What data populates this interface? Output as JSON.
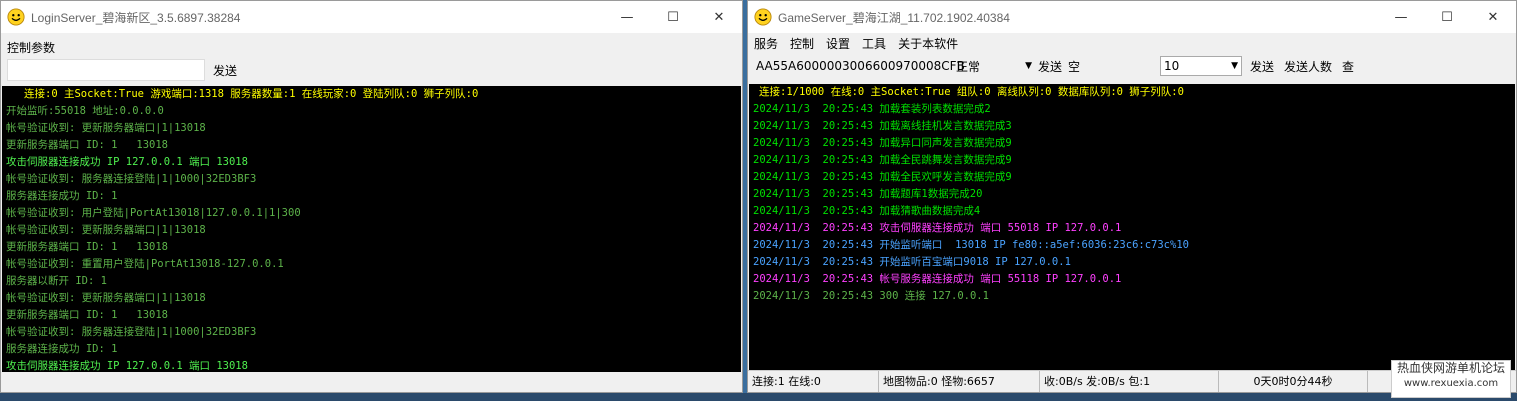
{
  "left": {
    "title": "LoginServer_碧海新区_3.5.6897.38284",
    "menu": [
      "控制参数"
    ],
    "send_label": "发送",
    "console_header": "连接:0 主Socket:True 游戏端口:1318 服务器数量:1 在线玩家:0 登陆列队:0 狮子列队:0",
    "lines": [
      {
        "t": "开始监听:55018 地址:0.0.0.0",
        "c": "dg"
      },
      {
        "t": "帐号验证收到: 更新服务器端口|1|13018",
        "c": "dg"
      },
      {
        "t": "更新服务器端口 ID: 1   13018",
        "c": "dg"
      },
      {
        "t": "攻击伺服器连接成功 IP 127.0.0.1 端口 13018",
        "c": "bg"
      },
      {
        "t": "帐号验证收到: 服务器连接登陆|1|1000|32ED3BF3",
        "c": "dg"
      },
      {
        "t": "服务器连接成功 ID: 1",
        "c": "dg"
      },
      {
        "t": "帐号验证收到: 用户登陆|PortAt13018|127.0.0.1|1|300",
        "c": "dg"
      },
      {
        "t": "帐号验证收到: 更新服务器端口|1|13018",
        "c": "dg"
      },
      {
        "t": "更新服务器端口 ID: 1   13018",
        "c": "dg"
      },
      {
        "t": "帐号验证收到: 重置用户登陆|PortAt13018-127.0.0.1",
        "c": "dg"
      },
      {
        "t": "服务器以断开 ID: 1",
        "c": "dg"
      },
      {
        "t": "帐号验证收到: 更新服务器端口|1|13018",
        "c": "dg"
      },
      {
        "t": "更新服务器端口 ID: 1   13018",
        "c": "dg"
      },
      {
        "t": "帐号验证收到: 服务器连接登陆|1|1000|32ED3BF3",
        "c": "dg"
      },
      {
        "t": "服务器连接成功 ID: 1",
        "c": "dg"
      },
      {
        "t": "攻击伺服器连接成功 IP 127.0.0.1 端口 13018",
        "c": "bg"
      }
    ]
  },
  "right": {
    "title": "GameServer_碧海江湖_11.702.1902.40384",
    "menu": [
      "服务",
      "控制",
      "设置",
      "工具",
      "关于本软件"
    ],
    "toolbar": {
      "id": "AA55A6000003006600970008CFB",
      "mode": "正常",
      "send1": "发送",
      "empty": "空",
      "count": "10",
      "send2": "发送",
      "send_count": "发送人数",
      "query": "查"
    },
    "console_header": "连接:1/1000 在线:0 主Socket:True 组队:0 离线队列:0 数据库队列:0 狮子列队:0",
    "lines": [
      {
        "t": "2024/11/3  20:25:43 加载套装列表数据完成2",
        "c": "g"
      },
      {
        "t": "2024/11/3  20:25:43 加载离线挂机发言数据完成3",
        "c": "g"
      },
      {
        "t": "2024/11/3  20:25:43 加载异口同声发言数据完成9",
        "c": "g"
      },
      {
        "t": "2024/11/3  20:25:43 加载全民跳舞发言数据完成9",
        "c": "g"
      },
      {
        "t": "2024/11/3  20:25:43 加载全民欢呼发言数据完成9",
        "c": "g"
      },
      {
        "t": "2024/11/3  20:25:43 加载题库1数据完成20",
        "c": "g"
      },
      {
        "t": "2024/11/3  20:25:43 加载猜歌曲数据完成4",
        "c": "g"
      },
      {
        "t": "2024/11/3  20:25:43 攻击伺服器连接成功 端口 55018 IP 127.0.0.1",
        "c": "mg"
      },
      {
        "t": "2024/11/3  20:25:43 开始监听端口  13018 IP fe80::a5ef:6036:23c6:c73c%10",
        "c": "bl"
      },
      {
        "t": "2024/11/3  20:25:43 开始监听百宝端口9018 IP 127.0.0.1",
        "c": "bl"
      },
      {
        "t": "2024/11/3  20:25:43 帐号服务器连接成功 端口 55118 IP 127.0.0.1",
        "c": "mg"
      },
      {
        "t": "2024/11/3  20:25:43 300 连接 127.0.0.1",
        "c": "dg"
      }
    ],
    "status": {
      "conn": "连接:1 在线:0",
      "map": "地图物品:0 怪物:6657",
      "net": "收:0B/s 发:0B/s 包:1",
      "uptime": "0天0时0分44秒"
    }
  },
  "watermark": {
    "line1": "热血侠网游单机论坛",
    "line2": "www.rexuexia.com"
  }
}
